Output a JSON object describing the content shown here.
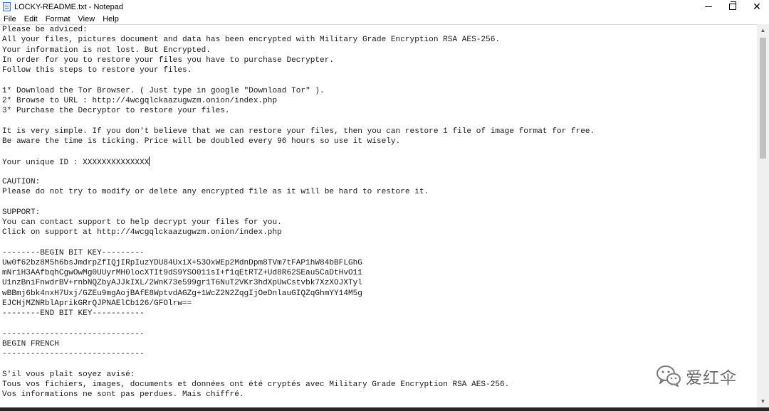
{
  "window": {
    "title": "LOCKY-README.txt - Notepad",
    "controls": {
      "minimize": "",
      "maximize": "",
      "close": "✕"
    }
  },
  "menubar": {
    "items": [
      "File",
      "Edit",
      "Format",
      "View",
      "Help"
    ]
  },
  "editor": {
    "lines": [
      "Please be adviced:",
      "All your files, pictures document and data has been encrypted with Military Grade Encryption RSA AES-256.",
      "Your information is not lost. But Encrypted.",
      "In order for you to restore your files you have to purchase Decrypter.",
      "Follow this steps to restore your files.",
      "",
      "1* Download the Tor Browser. ( Just type in google \"Download Tor\" ).",
      "2* Browse to URL : http://4wcgqlckaazugwzm.onion/index.php",
      "3* Purchase the Decryptor to restore your files.",
      "",
      "It is very simple. If you don't believe that we can restore your files, then you can restore 1 file of image format for free.",
      "Be aware the time is ticking. Price will be doubled every 96 hours so use it wisely.",
      "",
      "Your unique ID : XXXXXXXXXXXXXX",
      "",
      "CAUTION:",
      "Please do not try to modify or delete any encrypted file as it will be hard to restore it.",
      "",
      "SUPPORT:",
      "You can contact support to help decrypt your files for you.",
      "Click on support at http://4wcgqlckaazugwzm.onion/index.php",
      "",
      "--------BEGIN BIT KEY---------",
      "Uw0f62bz8M5h6bsJmdrpZfIQjIRpIuzYDU84UxiX+53OxWEp2MdnDpm8TVm7tFAP1hW84bBFLGhG",
      "mNr1H3AAfbqhCgwOwMg0UUyrMH0locXTIt9dS9YSO011sI+f1qEtRTZ+Ud8R62SEau5CaDtHvO11",
      "U1nzBniFnwdrBV+rnbNQZbyAJJkIXL/2WnK73e599gr1T6NuT2VKr3hdXpUwCstvbk7XzXOJXTyl",
      "wBBmj6bk4nxH7Uxj/GZEu9mgAojBAfE8WptvdAGZg+1WcZ2N2ZqgIjOeDnlauGIQZqGhmYY14M5g",
      "EJCHjMZNRblAprikGRrQJPNAElCb126/GFOlrw==",
      "--------END BIT KEY-----------",
      "",
      "------------------------------",
      "BEGIN FRENCH",
      "------------------------------",
      "",
      "S'il vous plaît soyez avisé:",
      "Tous vos fichiers, images, documents et données ont été cryptés avec Military Grade Encryption RSA AES-256.",
      "Vos informations ne sont pas perdues. Mais chiffré."
    ],
    "caret_line": 13
  },
  "scrollbar": {
    "up_arrow": "▲",
    "down_arrow": "▼"
  },
  "watermark": {
    "text": "爱红伞"
  },
  "colors": {
    "text": "#1a1a1a",
    "window_bg": "#ffffff",
    "scrollbar_bg": "#f0f0f0",
    "thumb": "#c1c1c1"
  }
}
